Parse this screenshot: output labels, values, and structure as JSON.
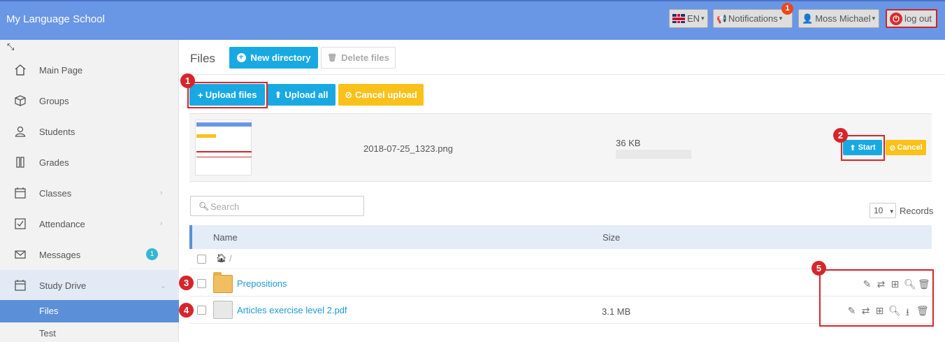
{
  "app": {
    "brand": "My Language School",
    "language": "EN",
    "notifications_label": "Notifications",
    "notifications_count": "1",
    "user": "Moss Michael",
    "logout": "log out"
  },
  "sidebar": {
    "items": [
      {
        "label": "Main Page",
        "icon": "home-icon"
      },
      {
        "label": "Groups",
        "icon": "cube-icon"
      },
      {
        "label": "Students",
        "icon": "user-icon"
      },
      {
        "label": "Grades",
        "icon": "ruler-icon"
      },
      {
        "label": "Classes",
        "icon": "calendar-icon"
      },
      {
        "label": "Attendance",
        "icon": "checkbox-icon"
      },
      {
        "label": "Messages",
        "icon": "envelope-icon",
        "badge": "1"
      },
      {
        "label": "Study Drive",
        "icon": "calendar-icon"
      }
    ],
    "sub_items": [
      {
        "label": "Files",
        "active": true
      },
      {
        "label": "Test",
        "active": false
      }
    ]
  },
  "main": {
    "title": "Files",
    "new_directory": "New directory",
    "delete_files": "Delete files",
    "upload_files": "Upload files",
    "upload_all": "Upload all",
    "cancel_upload": "Cancel upload",
    "upload_item": {
      "filename": "2018-07-25_1323.png",
      "size": "36 KB",
      "progress": 0,
      "start": "Start",
      "cancel": "Cancel"
    },
    "search_placeholder": "Search",
    "records_value": "10",
    "records_label": "Records",
    "table": {
      "col_name": "Name",
      "col_size": "Size",
      "breadcrumb_sep": "/",
      "rows": [
        {
          "name": "Prepositions",
          "type": "folder",
          "size": ""
        },
        {
          "name": "Articles exercise level 2.pdf",
          "type": "file",
          "size": "3.1 MB"
        }
      ]
    }
  },
  "annotations": [
    "1",
    "2",
    "3",
    "4",
    "5"
  ],
  "colors": {
    "topbar": "#6a96e6",
    "primary": "#18a9e3",
    "warning": "#fbc11b",
    "annotation": "#d6252b",
    "link": "#1a9bd7"
  }
}
